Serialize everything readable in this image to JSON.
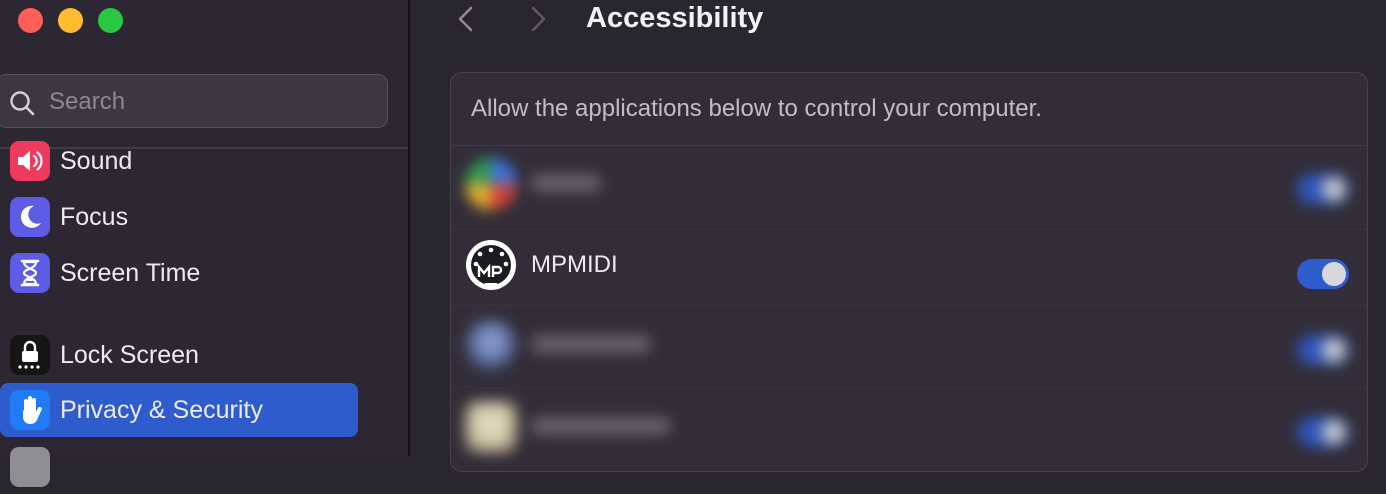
{
  "window": {
    "traffic_lights": [
      {
        "name": "close",
        "color": "#ff5f57"
      },
      {
        "name": "minimize",
        "color": "#febc2e"
      },
      {
        "name": "zoom",
        "color": "#28c840"
      }
    ]
  },
  "search": {
    "placeholder": "Search",
    "value": ""
  },
  "sidebar": {
    "items": [
      {
        "label": "Sound",
        "icon": "speaker-icon",
        "color": "#ee3a5c"
      },
      {
        "label": "Focus",
        "icon": "moon-icon",
        "color": "#5e5ce6"
      },
      {
        "label": "Screen Time",
        "icon": "hourglass-icon",
        "color": "#5e5ce6"
      },
      {
        "label": "Lock Screen",
        "icon": "lock-icon",
        "color": "#151515"
      },
      {
        "label": "Privacy & Security",
        "icon": "hand-icon",
        "color": "#1f7cf6",
        "selected": true
      }
    ],
    "selection_color": "#2f5ccc"
  },
  "header": {
    "title": "Accessibility"
  },
  "panel": {
    "description": "Allow the applications below to control your computer.",
    "apps": [
      {
        "name": "",
        "enabled": true,
        "blurred": true
      },
      {
        "name": "MPMIDI",
        "enabled": true,
        "blurred": false
      },
      {
        "name": "",
        "enabled": true,
        "blurred": true
      },
      {
        "name": "",
        "enabled": true,
        "blurred": true
      }
    ]
  },
  "accent_color": "#2f5ccc"
}
